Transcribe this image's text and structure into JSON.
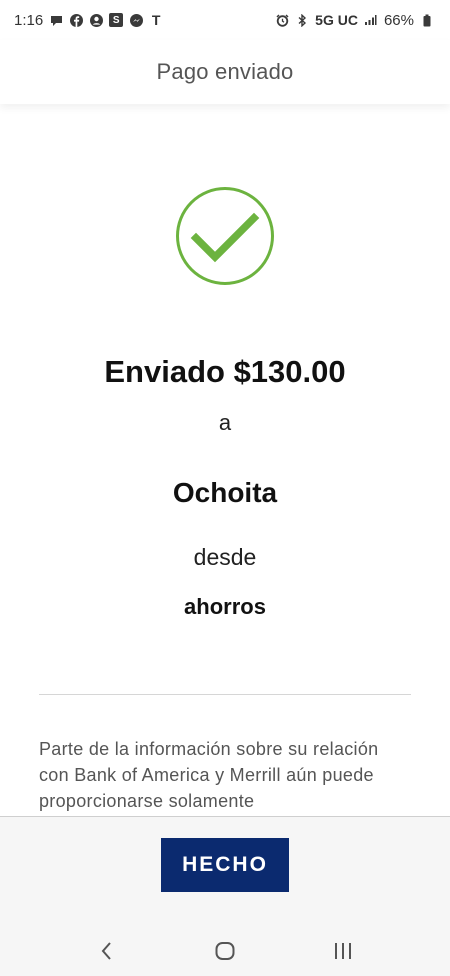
{
  "status_bar": {
    "time": "1:16",
    "left_icons": [
      "chat-bubble-icon",
      "facebook-icon",
      "profile-icon",
      "s-app-icon",
      "messenger-icon",
      "t-mobile-icon"
    ],
    "s_glyph": "S",
    "t_glyph": "T",
    "network": "5G UC",
    "battery": "66%"
  },
  "header": {
    "title": "Pago enviado"
  },
  "confirmation": {
    "amount_text": "Enviado $130.00",
    "connector_to": "a",
    "recipient": "Ochoita",
    "connector_from": "desde",
    "account": "ahorros",
    "check_color": "#6cb33f"
  },
  "disclosure": {
    "text": "Parte de la información sobre su relación con Bank of America y Merrill aún puede proporcionarse solamente"
  },
  "footer": {
    "done_label": "HECHO",
    "button_color": "#0b2a6f"
  },
  "nav_bar": {
    "back_icon": "back-chevron-icon",
    "home_icon": "home-icon",
    "recents_icon": "recents-icon"
  }
}
